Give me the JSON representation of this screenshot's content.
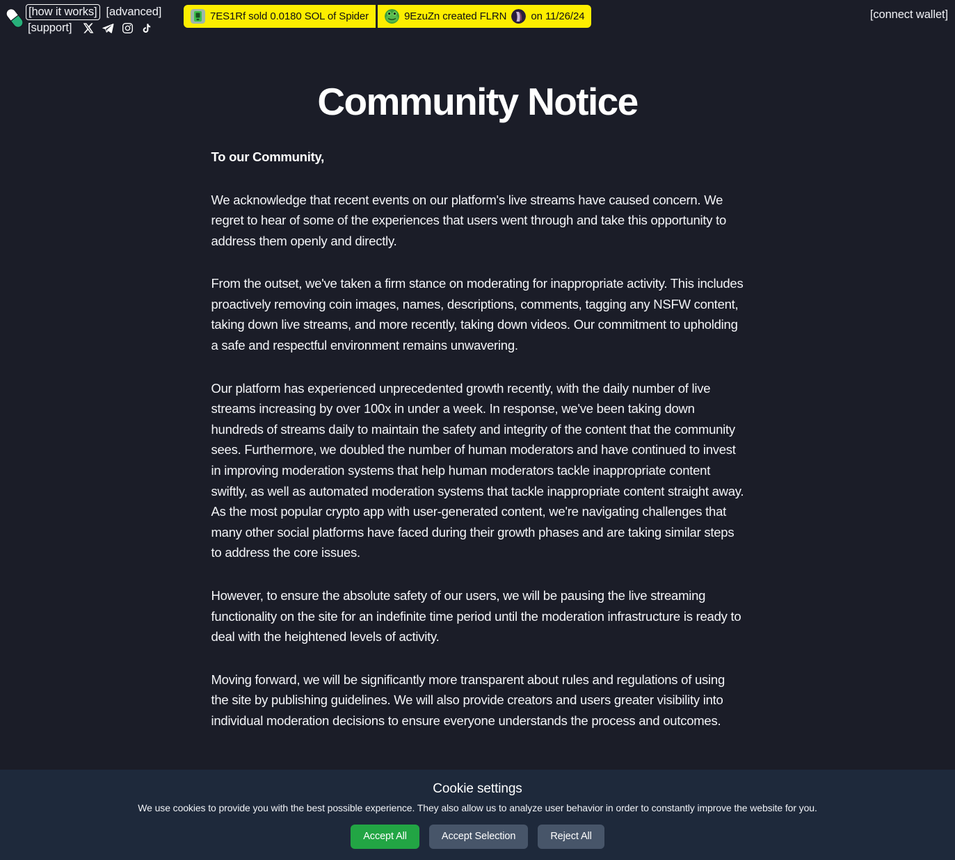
{
  "header": {
    "logo_icon": "pill-capsule-icon",
    "nav_row1": [
      {
        "label": "[how it works]",
        "boxed": true
      },
      {
        "label": "[advanced]",
        "boxed": false
      }
    ],
    "nav_row2": [
      {
        "label": "[support]",
        "boxed": false
      }
    ],
    "social_icons": [
      "x-twitter-icon",
      "telegram-icon",
      "instagram-icon",
      "tiktok-icon"
    ],
    "connect_wallet_label": "[connect wallet]"
  },
  "ticker": {
    "background_color": "#fdee00",
    "text_color": "#111111",
    "items": [
      {
        "avatar_icon": "token-avatar-green-icon",
        "text": "7ES1Rf  sold 0.0180 SOL of Spider"
      },
      {
        "avatar_icon": "frog-avatar-icon",
        "text": "9EzuZn created FLRN",
        "avatar_icon_2": "purple-avatar-icon",
        "text_2": "on 11/26/24"
      }
    ]
  },
  "main": {
    "title": "Community Notice",
    "salutation": "To our Community,",
    "paragraphs": [
      "We acknowledge that recent events on our platform's live streams have caused concern. We regret to hear of some of the experiences that users went through and take this opportunity to address them openly and directly.",
      "From the outset, we've taken a firm stance on moderating for inappropriate activity. This includes proactively removing coin images, names, descriptions, comments, tagging any NSFW content, taking down live streams, and more recently, taking down videos. Our commitment to upholding a safe and respectful environment remains unwavering.",
      "Our platform has experienced unprecedented growth recently, with the daily number of live streams increasing by over 100x in under a week. In response, we've been taking down hundreds of streams daily to maintain the safety and integrity of the content that the community sees. Furthermore, we doubled the number of human moderators and have continued to invest in improving moderation systems that help human moderators tackle inappropriate content swiftly, as well as automated moderation systems that tackle inappropriate content straight away. As the most popular crypto app with user-generated content, we're navigating challenges that many other social platforms have faced during their growth phases and are taking similar steps to address the core issues.",
      "However, to ensure the absolute safety of our users, we will be pausing the live streaming functionality on the site for an indefinite time period until the moderation infrastructure is ready to deal with the heightened levels of activity.",
      "Moving forward, we will be significantly more transparent about rules and regulations of using the site by publishing guidelines. We will also provide creators and users greater visibility into individual moderation decisions to ensure everyone understands the process and outcomes."
    ]
  },
  "cookie_banner": {
    "title": "Cookie settings",
    "description": "We use cookies to provide you with the best possible experience. They also allow us to analyze user behavior in order to constantly improve the website for you.",
    "accept_all_label": "Accept All",
    "accept_selection_label": "Accept Selection",
    "reject_all_label": "Reject All",
    "accept_all_color": "#22a544",
    "neutral_button_color": "#475569",
    "background_color": "#1e293b"
  },
  "theme": {
    "page_background": "#1b1d28",
    "text_color": "#f4f5f8"
  }
}
